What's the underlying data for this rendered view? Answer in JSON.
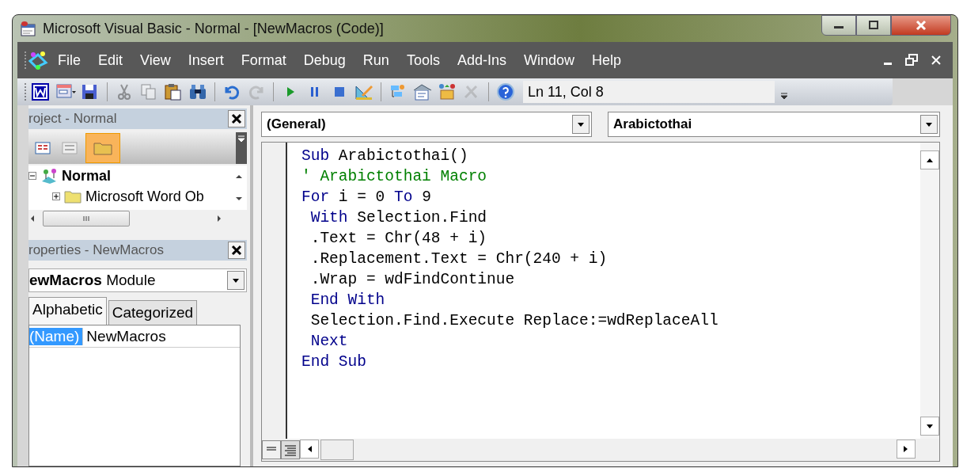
{
  "window": {
    "title": "Microsoft Visual Basic - Normal - [NewMacros (Code)]"
  },
  "menu_bar": {
    "items": [
      "File",
      "Edit",
      "View",
      "Insert",
      "Format",
      "Debug",
      "Run",
      "Tools",
      "Add-Ins",
      "Window",
      "Help"
    ]
  },
  "toolbar": {
    "buttons": [
      {
        "kind": "word",
        "disabled": false
      },
      {
        "kind": "userform",
        "disabled": false
      },
      {
        "kind": "save",
        "disabled": false
      },
      {
        "kind": "separator"
      },
      {
        "kind": "cut",
        "disabled": true
      },
      {
        "kind": "copy",
        "disabled": true
      },
      {
        "kind": "paste",
        "disabled": false
      },
      {
        "kind": "find",
        "disabled": false
      },
      {
        "kind": "separator"
      },
      {
        "kind": "undo",
        "disabled": false
      },
      {
        "kind": "redo",
        "disabled": true
      },
      {
        "kind": "separator"
      },
      {
        "kind": "run",
        "disabled": false
      },
      {
        "kind": "break",
        "disabled": false
      },
      {
        "kind": "reset",
        "disabled": false
      },
      {
        "kind": "design",
        "disabled": false
      },
      {
        "kind": "separator"
      },
      {
        "kind": "explorer",
        "disabled": false
      },
      {
        "kind": "properties",
        "disabled": false
      },
      {
        "kind": "objects",
        "disabled": false
      },
      {
        "kind": "toolbox",
        "disabled": true
      },
      {
        "kind": "separator"
      },
      {
        "kind": "help",
        "disabled": false
      }
    ],
    "position": "Ln 11, Col 8"
  },
  "project_panel": {
    "title": "roject - Normal",
    "view_buttons": [
      {
        "kind": "code",
        "selected": false
      },
      {
        "kind": "form",
        "selected": false
      },
      {
        "kind": "folders",
        "selected": true
      }
    ],
    "tree": [
      {
        "label": "Normal",
        "expanded": true,
        "children": [
          {
            "label": "Microsoft Word Ob",
            "expanded": false
          }
        ]
      }
    ]
  },
  "properties_panel": {
    "title": "roperties - NewMacros",
    "object": "**ewMacros** Module",
    "tabs": [
      {
        "label": "Alphabetic",
        "selected": true
      },
      {
        "label": "Categorized",
        "selected": false
      }
    ],
    "rows": [
      {
        "name": "(Name)",
        "value": "NewMacros",
        "selected": true
      }
    ]
  },
  "code_window": {
    "object": "(General)",
    "procedure": "Arabictothai",
    "lines": [
      [
        {
          "kind": "keyword",
          "text": "Sub"
        },
        {
          "kind": "plain",
          "text": " Arabictothai()"
        }
      ],
      [
        {
          "kind": "comment",
          "text": "' Arabictothai Macro"
        }
      ],
      [
        {
          "kind": "keyword",
          "text": "For"
        },
        {
          "kind": "plain",
          "text": " i = 0 "
        },
        {
          "kind": "keyword",
          "text": "To"
        },
        {
          "kind": "plain",
          "text": " 9"
        }
      ],
      [
        {
          "kind": "keyword",
          "text": " With"
        },
        {
          "kind": "plain",
          "text": " Selection.Find"
        }
      ],
      [
        {
          "kind": "plain",
          "text": " .Text = Chr(48 + i)"
        }
      ],
      [
        {
          "kind": "plain",
          "text": " .Replacement.Text = Chr(240 + i)"
        }
      ],
      [
        {
          "kind": "plain",
          "text": " .Wrap = wdFindContinue"
        }
      ],
      [
        {
          "kind": "keyword",
          "text": " End With"
        }
      ],
      [
        {
          "kind": "plain",
          "text": " Selection.Find.Execute Replace:=wdReplaceAll"
        }
      ],
      [
        {
          "kind": "keyword",
          "text": " Next"
        }
      ],
      [
        {
          "kind": "keyword",
          "text": "End Sub"
        }
      ]
    ]
  }
}
